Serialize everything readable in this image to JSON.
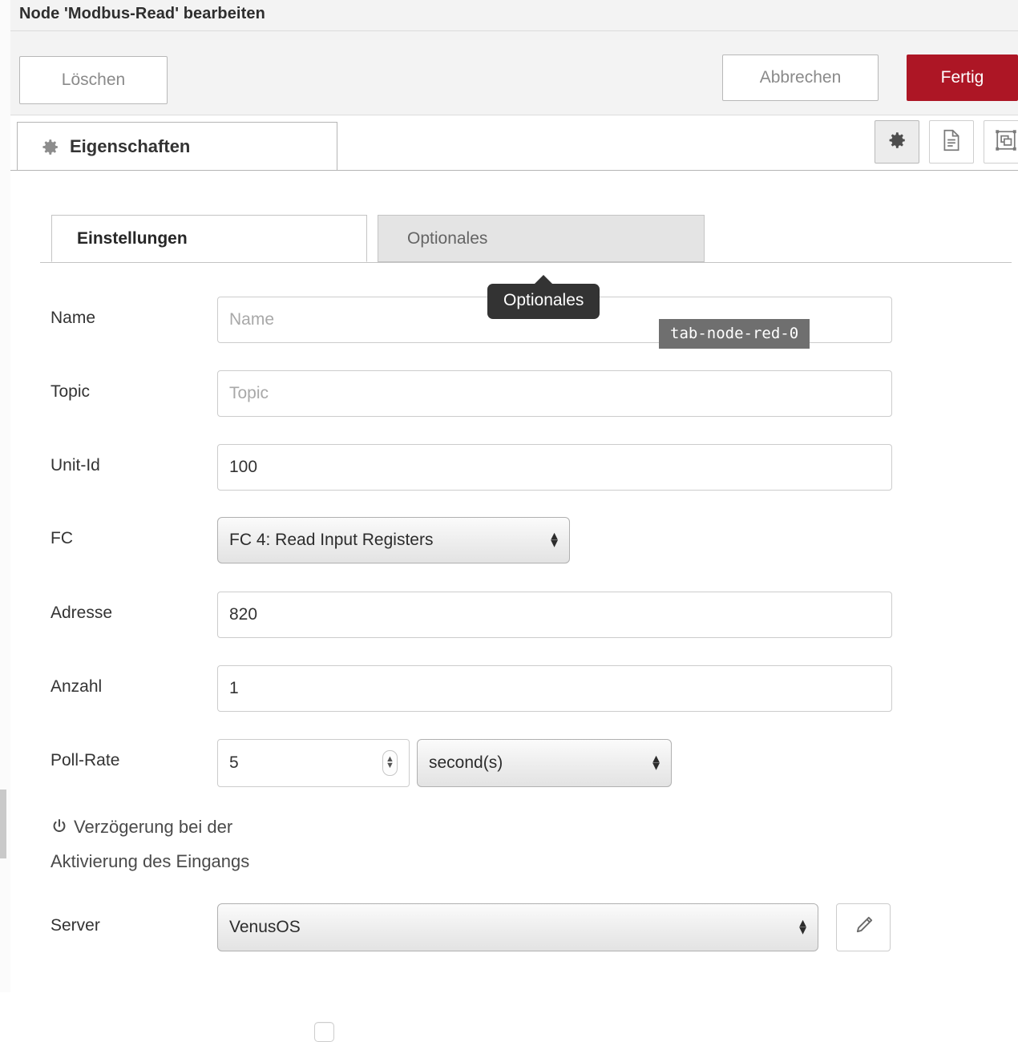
{
  "header": {
    "title": "Node 'Modbus-Read' bearbeiten"
  },
  "toolbar": {
    "delete_label": "Löschen",
    "cancel_label": "Abbrechen",
    "done_label": "Fertig",
    "done_color": "#ad1625"
  },
  "tabstrip": {
    "properties_tab_label": "Eigenschaften",
    "properties_tab_icon": "gear-icon",
    "icon_buttons": [
      {
        "name": "gear-icon",
        "active": true
      },
      {
        "name": "description-icon",
        "active": false
      },
      {
        "name": "appearance-icon",
        "active": false
      }
    ]
  },
  "subtabs": [
    {
      "label": "Einstellungen",
      "active": true
    },
    {
      "label": "Optionales",
      "active": false
    }
  ],
  "tooltips": {
    "optionales": "Optionales",
    "tab_id": "tab-node-red-0"
  },
  "form": {
    "name": {
      "label": "Name",
      "value": "",
      "placeholder": "Name"
    },
    "topic": {
      "label": "Topic",
      "value": "",
      "placeholder": "Topic"
    },
    "unit_id": {
      "label": "Unit-Id",
      "value": "100"
    },
    "fc": {
      "label": "FC",
      "value": "FC 4: Read Input Registers"
    },
    "address": {
      "label": "Adresse",
      "value": "820"
    },
    "quantity": {
      "label": "Anzahl",
      "value": "1"
    },
    "poll_rate": {
      "label": "Poll-Rate",
      "value": "5",
      "unit": "second(s)"
    },
    "delay": {
      "icon": "power-icon",
      "label_line1": "Verzögerung bei der",
      "label_line2": "Aktivierung des Eingangs",
      "checked": false
    },
    "server": {
      "label": "Server",
      "value": "VenusOS",
      "edit_icon": "pencil-icon"
    }
  }
}
